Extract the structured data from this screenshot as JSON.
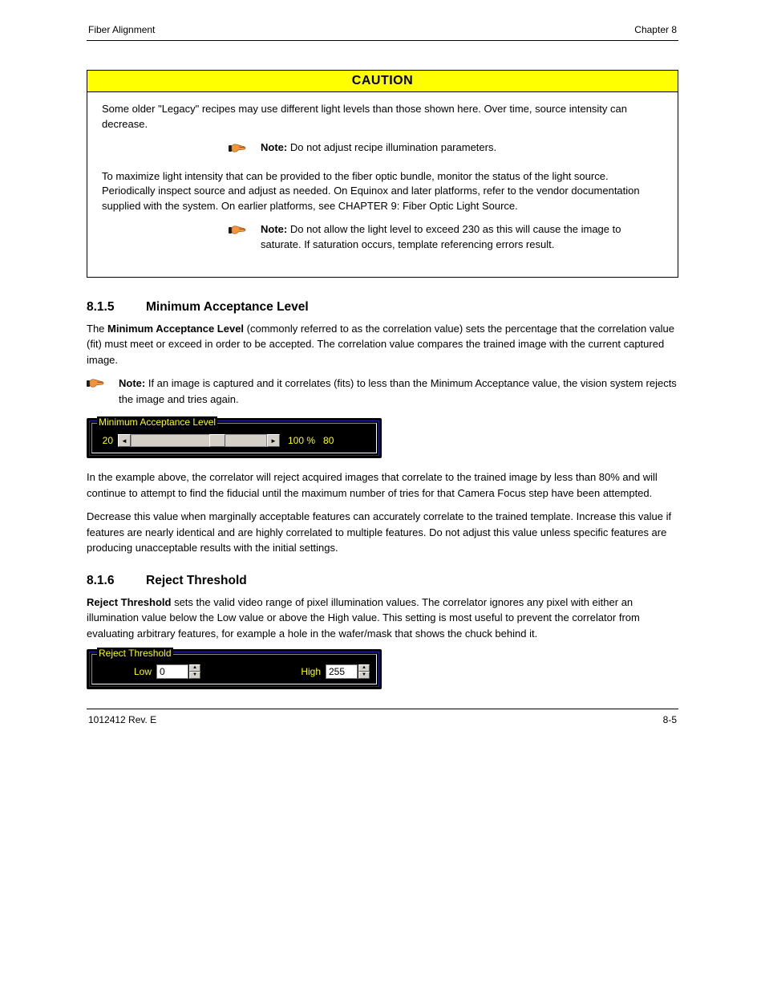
{
  "header": {
    "left": "Fiber Alignment",
    "right": "Chapter 8"
  },
  "caution": {
    "title": "CAUTION",
    "p1": "Some older \"Legacy\" recipes may use different light levels than those shown here.  Over time, source intensity can decrease.",
    "note1_label": "Note:  ",
    "note1_text": "Do not adjust recipe illumination parameters.",
    "p2": "To maximize light intensity that can be provided to the fiber optic bundle, monitor the status of the light source.  Periodically inspect source and adjust as needed.  On Equinox and later platforms, refer to the vendor documentation supplied with the system.  On earlier platforms, see CHAPTER 9: Fiber Optic Light Source.",
    "note2_label": "Note:  ",
    "note2_text": "Do not allow the light level to exceed 230 as this will cause the image to saturate.  If saturation occurs, template referencing errors result."
  },
  "section_mal": {
    "number": "8.1.5",
    "title": "Minimum Acceptance Level",
    "p1_a": "The ",
    "p1_b": "Minimum Acceptance Level",
    "p1_c": " (commonly referred to as the correlation value) sets the percentage that the correlation value (fit) must meet or exceed in order to be accepted.  The correlation value compares the trained image with the current captured image.",
    "note_label": "Note:  ",
    "note_text": "If an image is captured and it correlates (fits) to less than the Minimum Acceptance value, the vision system rejects the image and tries again."
  },
  "mal_widget": {
    "legend": "Minimum Acceptance Level",
    "left_value": "20",
    "right_percent": "100 %",
    "right_value": "80",
    "thumb_left_percent": 58
  },
  "mal_after": {
    "p1": "In the example above, the correlator will reject acquired images that correlate to the trained image by less than 80% and will continue to attempt to find the fiducial until the maximum number of tries for that Camera Focus step have been attempted.",
    "p2": "Decrease this value when marginally acceptable features can accurately correlate to the trained template.  Increase this value if features are nearly identical and are highly correlated to multiple features.  Do not adjust this value unless specific features are producing unacceptable results with the initial settings."
  },
  "section_rt": {
    "number": "8.1.6",
    "title": "Reject Threshold",
    "p1_a": "Reject Threshold",
    "p1_b": " sets the valid video range of pixel illumination values.  The correlator ignores any pixel with either an illumination value below the Low value or above the High value.  This setting is most useful to prevent the correlator from evaluating arbitrary features, for example a hole in the wafer/mask that shows the chuck behind it."
  },
  "rt_widget": {
    "legend": "Reject Threshold",
    "low_label": "Low",
    "low_value": "0",
    "high_label": "High",
    "high_value": "255"
  },
  "footer": {
    "left": "1012412 Rev. E",
    "right": "8-5"
  }
}
